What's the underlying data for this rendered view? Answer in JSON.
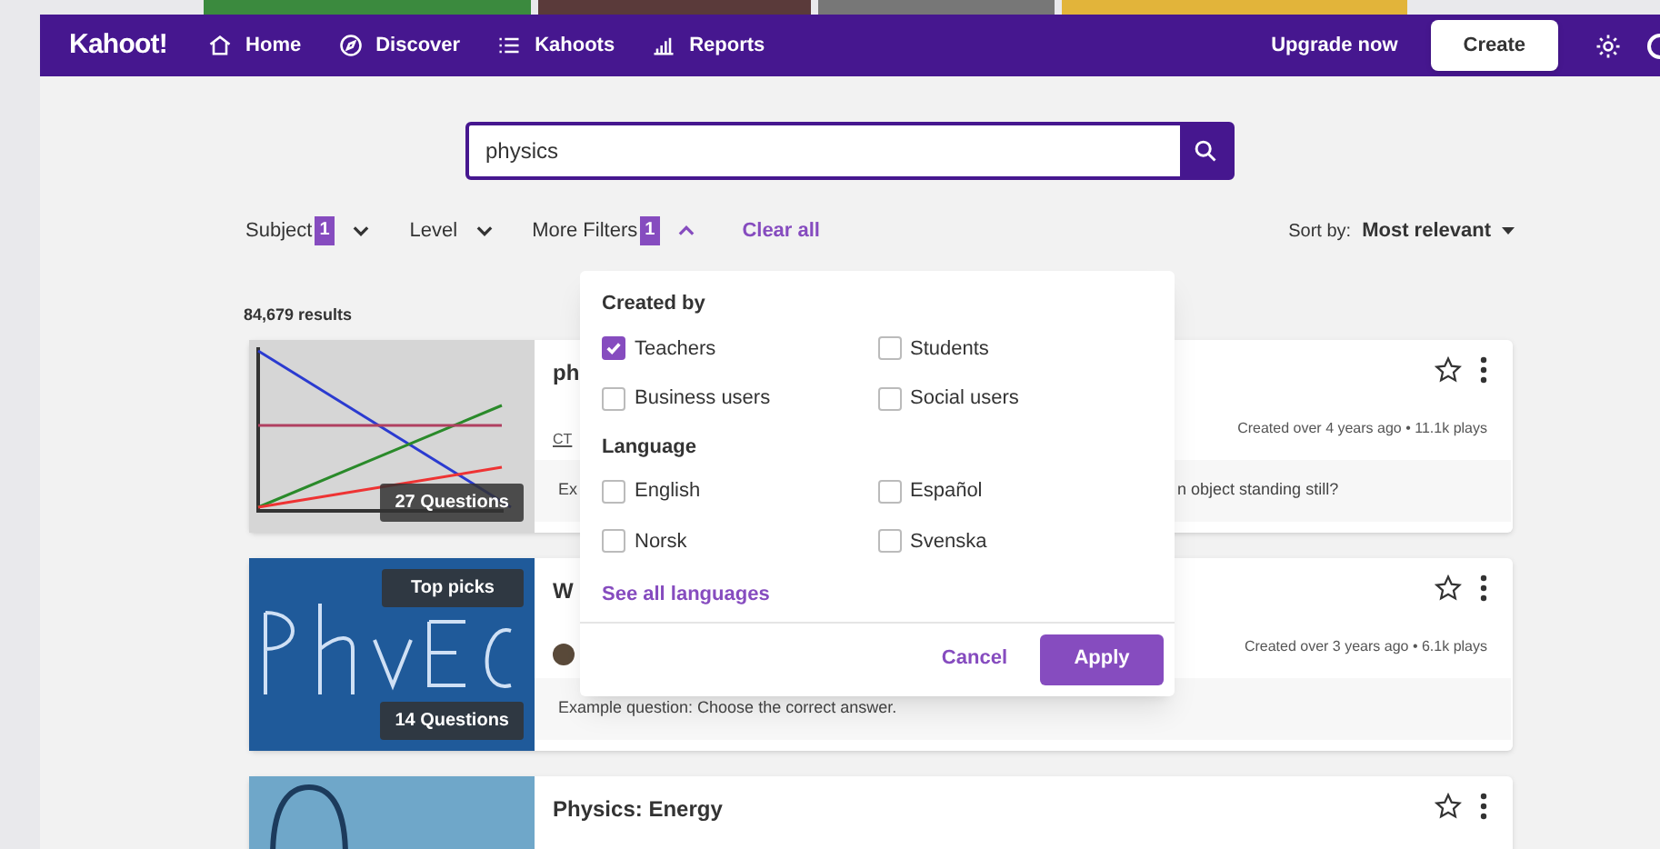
{
  "nav": {
    "logo": "Kahoot!",
    "items": [
      {
        "label": "Home"
      },
      {
        "label": "Discover"
      },
      {
        "label": "Kahoots"
      },
      {
        "label": "Reports"
      }
    ],
    "upgrade": "Upgrade now",
    "create": "Create"
  },
  "search": {
    "value": "physics"
  },
  "filters": [
    {
      "label": "Subject",
      "count": "1",
      "expanded": false
    },
    {
      "label": "Level",
      "expanded": false
    },
    {
      "label": "More Filters",
      "count": "1",
      "expanded": true
    }
  ],
  "clear": "Clear all",
  "sort": {
    "label": "Sort by:",
    "value": "Most relevant"
  },
  "results": "84,679 results",
  "dropdown": {
    "sections": [
      {
        "title": "Created by",
        "options": [
          {
            "label": "Teachers",
            "checked": true
          },
          {
            "label": "Students",
            "checked": false
          },
          {
            "label": "Business users",
            "checked": false
          },
          {
            "label": "Social users",
            "checked": false
          }
        ]
      },
      {
        "title": "Language",
        "options": [
          {
            "label": "English",
            "checked": false
          },
          {
            "label": "Español",
            "checked": false
          },
          {
            "label": "Norsk",
            "checked": false
          },
          {
            "label": "Svenska",
            "checked": false
          }
        ],
        "link": "See all languages"
      }
    ],
    "cancel": "Cancel",
    "apply": "Apply"
  },
  "cards": [
    {
      "kind": "graph",
      "title": "ph",
      "author": "CT",
      "meta": "Created over 4 years ago • 11.1k plays",
      "example": [
        "Ex",
        "n object standing still?"
      ],
      "badges": [
        "27 Questions"
      ]
    },
    {
      "kind": "blueprint",
      "title": "W",
      "avatar": true,
      "meta": "Created over 3 years ago • 6.1k plays",
      "example": [
        "Example question: Choose the correct answer."
      ],
      "badges": [
        "Top picks",
        "14 Questions"
      ]
    },
    {
      "kind": "photo",
      "title": "Physics: Energy"
    }
  ]
}
